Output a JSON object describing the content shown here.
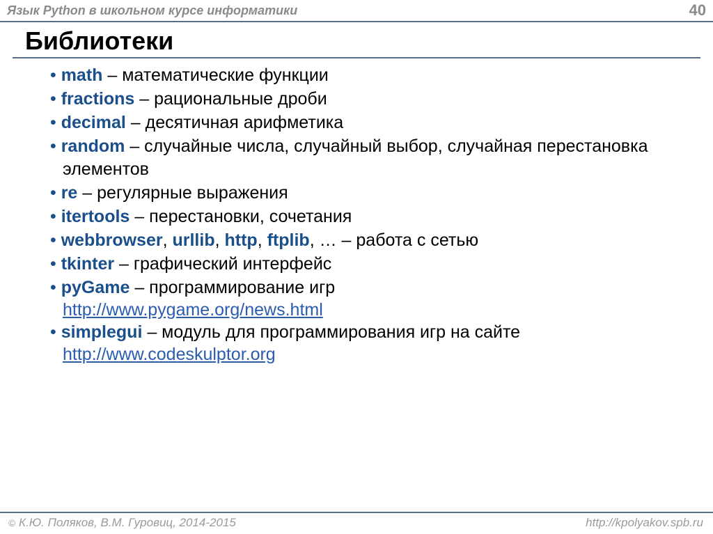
{
  "header": {
    "title": "Язык Python в школьном курсе информатики",
    "page_number": "40"
  },
  "slide_title": "Библиотеки",
  "items": [
    {
      "libs": [
        "math"
      ],
      "desc": " – математические функции"
    },
    {
      "libs": [
        "fractions"
      ],
      "desc": " – рациональные дроби"
    },
    {
      "libs": [
        "decimal"
      ],
      "desc": " – десятичная арифметика"
    },
    {
      "libs": [
        "random"
      ],
      "desc": " – случайные числа, случайный выбор, случайная перестановка элементов"
    },
    {
      "libs": [
        "re"
      ],
      "desc": " – регулярные выражения"
    },
    {
      "libs": [
        "itertools"
      ],
      "desc": " – перестановки, сочетания"
    },
    {
      "libs": [
        "webbrowser",
        "urllib",
        "http",
        "ftplib"
      ],
      "trailing": ", … ",
      "desc": "– работа с сетью"
    },
    {
      "libs": [
        "tkinter"
      ],
      "desc": " – графический интерфейс"
    },
    {
      "libs": [
        "pyGame"
      ],
      "desc": " – программирование игр",
      "link": "http://www.pygame.org/news.html"
    },
    {
      "libs": [
        "simplegui"
      ],
      "desc": " – модуль для программирования игр на сайте",
      "link": "http://www.codeskulptor.org"
    }
  ],
  "footer": {
    "copyright_symbol": "©",
    "copyright": " К.Ю. Поляков, В.М. Гуровиц, 2014-2015",
    "url": "http://kpolyakov.spb.ru"
  },
  "bullet": "•"
}
